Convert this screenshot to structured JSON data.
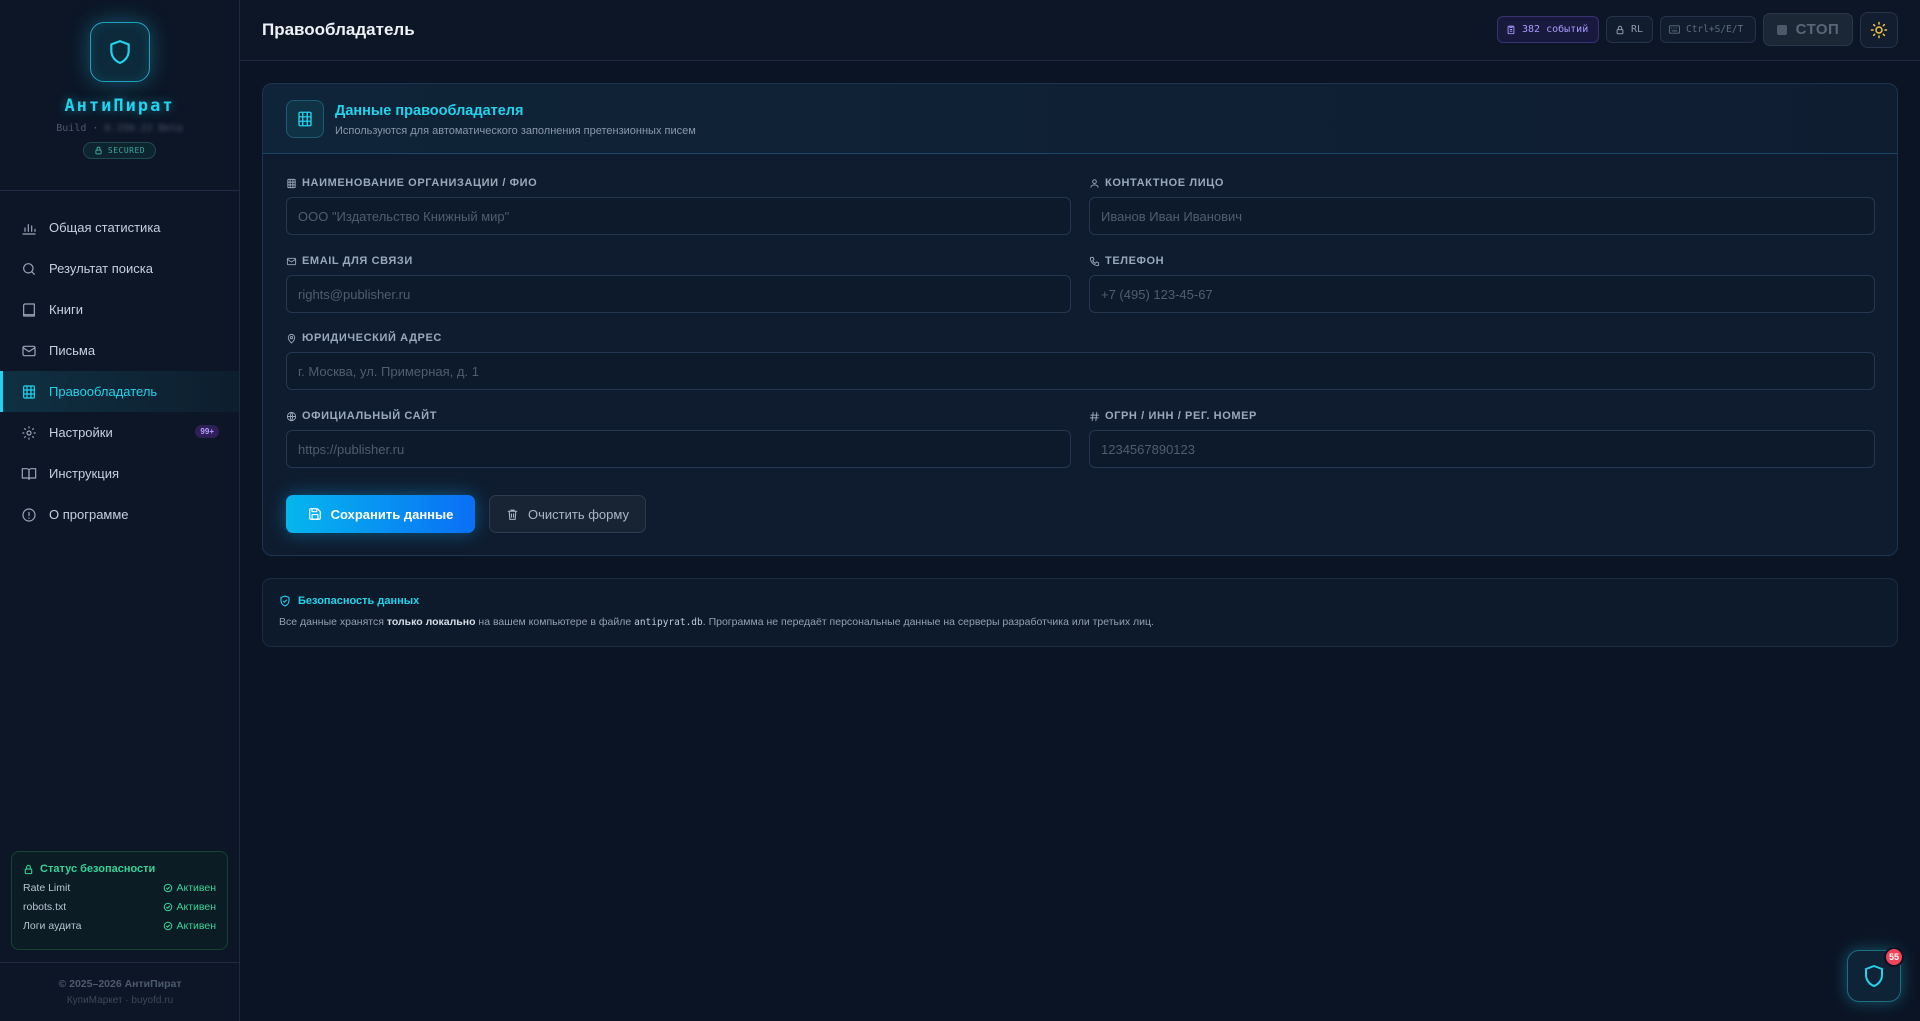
{
  "app": {
    "name": "АнтиПират",
    "build_prefix": "Build · ",
    "build_blurred": "0.150.22 Beta",
    "secured": "SECURED"
  },
  "sidebar": {
    "items": [
      {
        "label": "Общая статистика",
        "icon": "bar-chart-icon"
      },
      {
        "label": "Результат поиска",
        "icon": "search-icon"
      },
      {
        "label": "Книги",
        "icon": "book-icon"
      },
      {
        "label": "Письма",
        "icon": "mail-icon"
      },
      {
        "label": "Правообладатель",
        "icon": "building-icon",
        "active": true
      },
      {
        "label": "Настройки",
        "icon": "gear-icon",
        "badge": "99+"
      },
      {
        "label": "Инструкция",
        "icon": "open-book-icon"
      },
      {
        "label": "О программе",
        "icon": "info-icon"
      }
    ],
    "security": {
      "title": "Статус безопасности",
      "rows": [
        {
          "label": "Rate Limit",
          "status": "Активен"
        },
        {
          "label": "robots.txt",
          "status": "Активен"
        },
        {
          "label": "Логи аудита",
          "status": "Активен"
        }
      ]
    },
    "footer": {
      "copyright": "© 2025–2026 АнтиПират",
      "sub": "КупиМаркет · buyofd.ru"
    }
  },
  "topbar": {
    "title": "Правообладатель",
    "events": "382 событий",
    "rl": "RL",
    "shortcut": "Ctrl+S/E/T",
    "stop": "СТОП"
  },
  "card": {
    "title": "Данные правообладателя",
    "subtitle": "Используются для автоматического заполнения претензионных писем",
    "fields": {
      "org": {
        "label": "НАИМЕНОВАНИЕ ОРГАНИЗАЦИИ / ФИО",
        "placeholder": "ООО \"Издательство Книжный мир\"",
        "value": ""
      },
      "contact": {
        "label": "КОНТАКТНОЕ ЛИЦО",
        "placeholder": "Иванов Иван Иванович",
        "value": ""
      },
      "email": {
        "label": "EMAIL ДЛЯ СВЯЗИ",
        "placeholder": "rights@publisher.ru",
        "value": ""
      },
      "phone": {
        "label": "ТЕЛЕФОН",
        "placeholder": "+7 (495) 123-45-67",
        "value": ""
      },
      "address": {
        "label": "ЮРИДИЧЕСКИЙ АДРЕС",
        "placeholder": "г. Москва, ул. Примерная, д. 1",
        "value": ""
      },
      "site": {
        "label": "ОФИЦИАЛЬНЫЙ САЙТ",
        "placeholder": "https://publisher.ru",
        "value": ""
      },
      "ogrn": {
        "label": "ОГРН / ИНН / РЕГ. НОМЕР",
        "placeholder": "1234567890123",
        "value": ""
      }
    },
    "save_label": "Сохранить данные",
    "clear_label": "Очистить форму"
  },
  "notice": {
    "title": "Безопасность данных",
    "text_1": "Все данные хранятся ",
    "text_bold": "только локально",
    "text_2": " на вашем компьютере в файле ",
    "text_code": "antipyrat.db",
    "text_3": ". Программа не передаёт персональные данные на серверы разработчика или третьих лиц."
  },
  "fab": {
    "badge": "55"
  },
  "colors": {
    "accent": "#22d3ee",
    "success": "#34d399",
    "background": "#0b1424",
    "events_chip": "#a998ff",
    "badge_red": "#ef4459"
  }
}
